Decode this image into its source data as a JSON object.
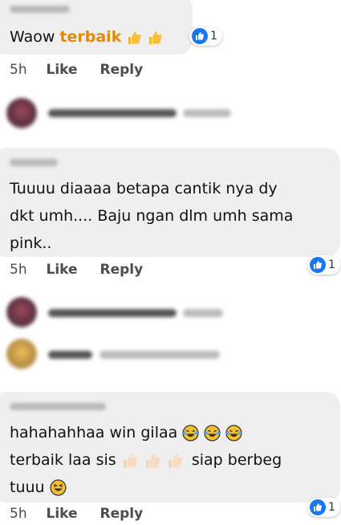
{
  "comments": [
    {
      "text_plain": "Waow ",
      "text_highlight": "terbaik",
      "emojis": [
        "thumbs-up",
        "thumbs-up"
      ],
      "time": "5h",
      "like": "Like",
      "reply": "Reply",
      "reaction_count": "1"
    },
    {
      "lines": [
        "Tuuuu diaaaa betapa cantik nya dy",
        "dkt umh.... Baju ngan dlm umh sama",
        "pink.."
      ],
      "time": "5h",
      "like": "Like",
      "reply": "Reply",
      "reaction_count": "1"
    },
    {
      "line1": "hahahahhaa win gilaa",
      "line2_a": "terbaik laa sis",
      "line2_b": "siap berbeg",
      "line3": "tuuu",
      "time": "5h",
      "like": "Like",
      "reply": "Reply",
      "reaction_count": "1"
    }
  ],
  "colors": {
    "bubble": "#efefef",
    "like_blue": "#1877f2",
    "highlight": "#e58a00"
  }
}
